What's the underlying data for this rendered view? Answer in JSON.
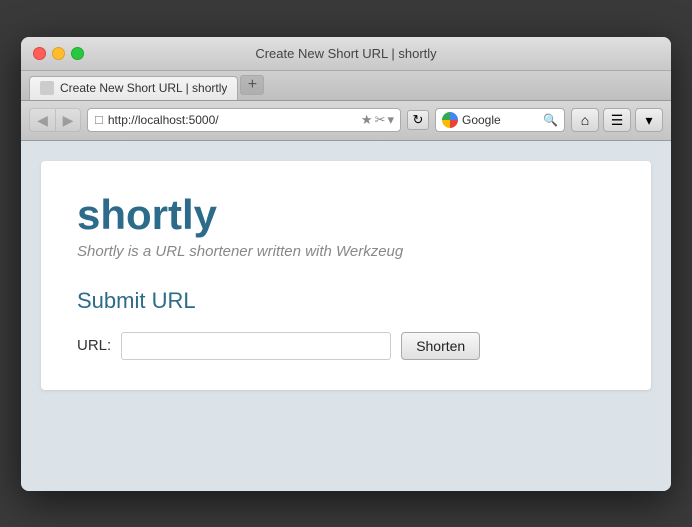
{
  "window": {
    "title": "Create New Short URL | shortly",
    "url": "http://localhost:5000/"
  },
  "tab": {
    "label": "Create New Short URL | shortly",
    "new_tab_icon": "+"
  },
  "toolbar": {
    "back_icon": "◀",
    "forward_icon": "▶",
    "address": "http://localhost:5000/",
    "bookmark_star": "★",
    "bookmark_star2": "✂",
    "dropdown_icon": "▾",
    "refresh_icon": "↻",
    "google_placeholder": "Google",
    "search_icon": "🔍",
    "home_icon": "⌂",
    "extensions_icon": "☰",
    "menu_icon": "▾"
  },
  "content": {
    "app_name": "shortly",
    "subtitle": "Shortly is a URL shortener written with Werkzeug",
    "section_title": "Submit URL",
    "url_label": "URL:",
    "url_placeholder": "",
    "shorten_button": "Shorten"
  }
}
